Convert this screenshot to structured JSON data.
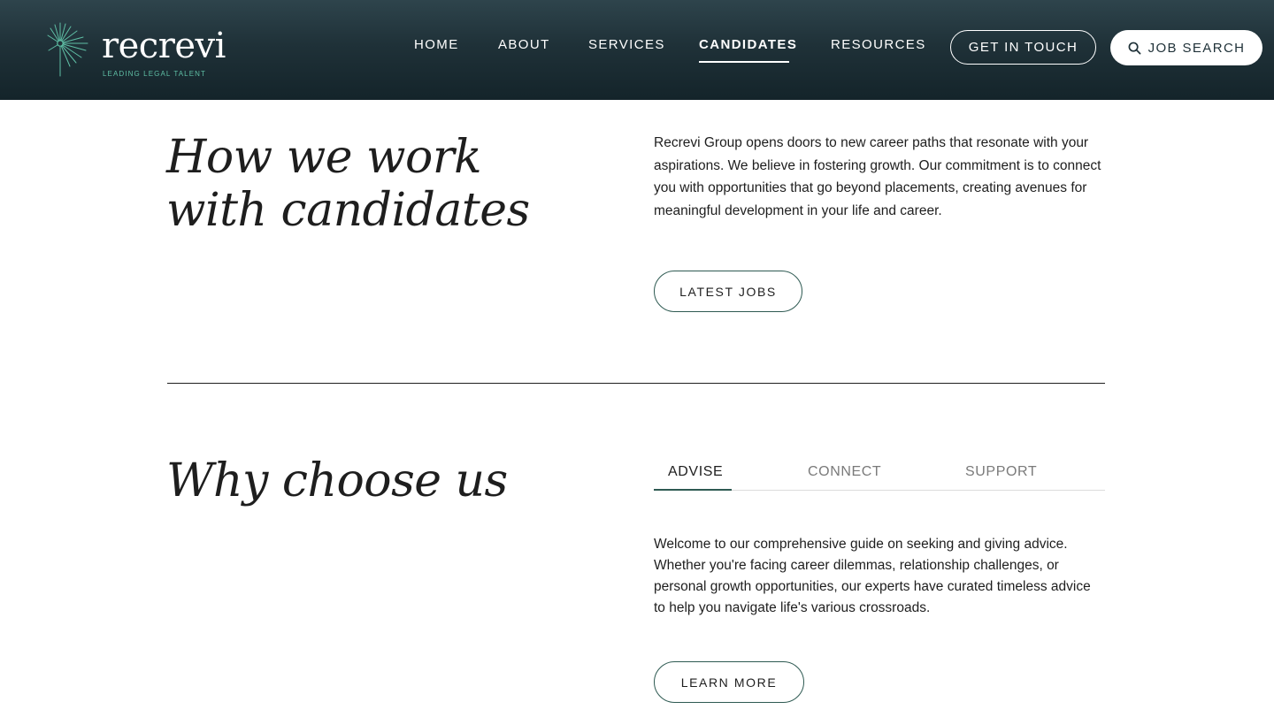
{
  "brand": {
    "name": "recrevi",
    "tagline": "LEADING LEGAL TALENT",
    "accent_color": "#5fbfa5"
  },
  "nav": {
    "items": [
      {
        "label": "HOME",
        "active": false
      },
      {
        "label": "ABOUT",
        "active": false
      },
      {
        "label": "SERVICES",
        "active": false
      },
      {
        "label": "CANDIDATES",
        "active": true
      },
      {
        "label": "RESOURCES",
        "active": false
      }
    ],
    "get_in_touch": "GET IN TOUCH",
    "job_search": "JOB SEARCH",
    "job_search_icon": "search-icon"
  },
  "work_section": {
    "heading": "How we work with candidates",
    "body": "Recrevi Group opens doors to new career paths that resonate with your aspirations. We believe in fostering growth. Our commitment is to connect you with opportunities that go beyond placements, creating avenues for meaningful development in your life and career.",
    "button_label": "LATEST JOBS"
  },
  "why_section": {
    "heading": "Why choose us",
    "tabs": [
      {
        "label": "ADVISE",
        "active": true
      },
      {
        "label": "CONNECT",
        "active": false
      },
      {
        "label": "SUPPORT",
        "active": false
      }
    ],
    "body": "Welcome to our comprehensive guide on seeking and giving advice. Whether you're facing career dilemmas, relationship challenges, or personal growth opportunities, our experts have curated timeless advice to help you navigate life's various crossroads.",
    "button_label": "LEARN MORE"
  },
  "colors": {
    "header_dark": "#1f3138",
    "text": "#1e1e1e",
    "button_border": "#2e5a52",
    "tab_inactive": "#7a7a7a"
  }
}
